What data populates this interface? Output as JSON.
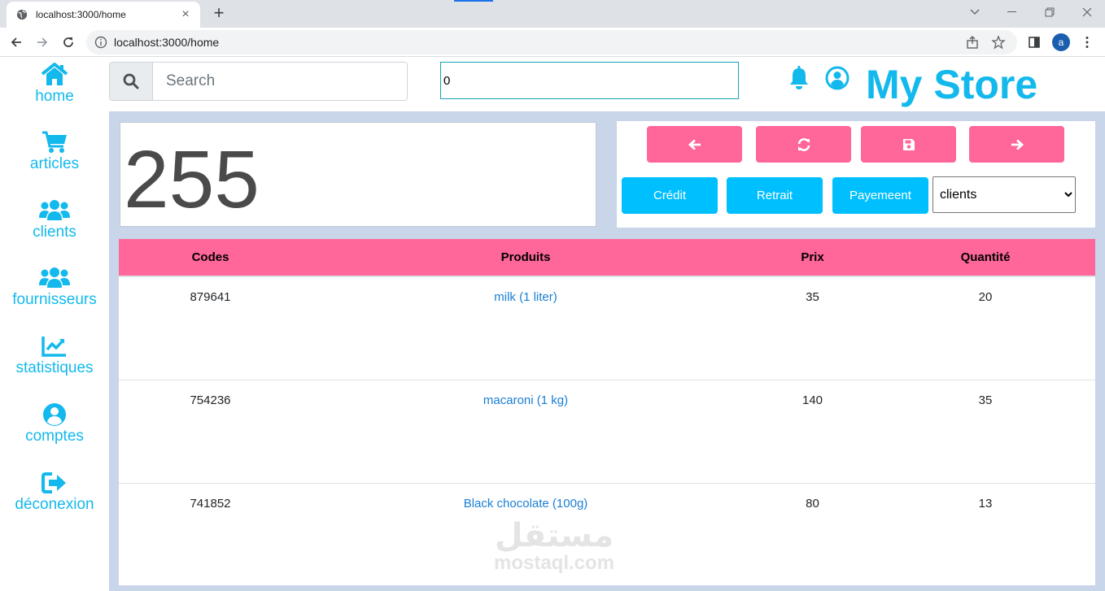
{
  "browser": {
    "tab_title": "localhost:3000/home",
    "url": "localhost:3000/home",
    "profile_initial": "a"
  },
  "sidebar": {
    "items": [
      {
        "label": "home",
        "icon": "home-icon"
      },
      {
        "label": "articles",
        "icon": "cart-icon"
      },
      {
        "label": "clients",
        "icon": "users-icon"
      },
      {
        "label": "fournisseurs",
        "icon": "users-icon"
      },
      {
        "label": "statistiques",
        "icon": "chart-line-icon"
      },
      {
        "label": "comptes",
        "icon": "user-circle-icon"
      },
      {
        "label": "déconexion",
        "icon": "sign-out-icon"
      }
    ]
  },
  "header": {
    "search_placeholder": "Search",
    "amount_value": "0",
    "brand": "My Store"
  },
  "total": {
    "value": "255"
  },
  "actions": {
    "nav_buttons": [
      "arrow-left-icon",
      "refresh-icon",
      "save-icon",
      "arrow-right-icon"
    ],
    "credit_label": "Crédit",
    "retrait_label": "Retrait",
    "payement_label": "Payemeent",
    "client_select": {
      "selected": "clients",
      "options": [
        "clients"
      ]
    }
  },
  "table": {
    "headers": [
      "Codes",
      "Produits",
      "Prix",
      "Quantité"
    ],
    "rows": [
      {
        "code": "879641",
        "product": "milk (1 liter)",
        "price": "35",
        "quantity": "20"
      },
      {
        "code": "754236",
        "product": "macaroni (1 kg)",
        "price": "140",
        "quantity": "35"
      },
      {
        "code": "741852",
        "product": "Black chocolate (100g)",
        "price": "80",
        "quantity": "13"
      }
    ]
  },
  "watermark": {
    "arabic": "مستقل",
    "latin": "mostaql.com"
  },
  "colors": {
    "accent": "#13b9ec",
    "pink": "#ff6699",
    "cyan": "#00bfff",
    "link": "#1a7fd4",
    "content_bg": "#c9d5e8"
  }
}
